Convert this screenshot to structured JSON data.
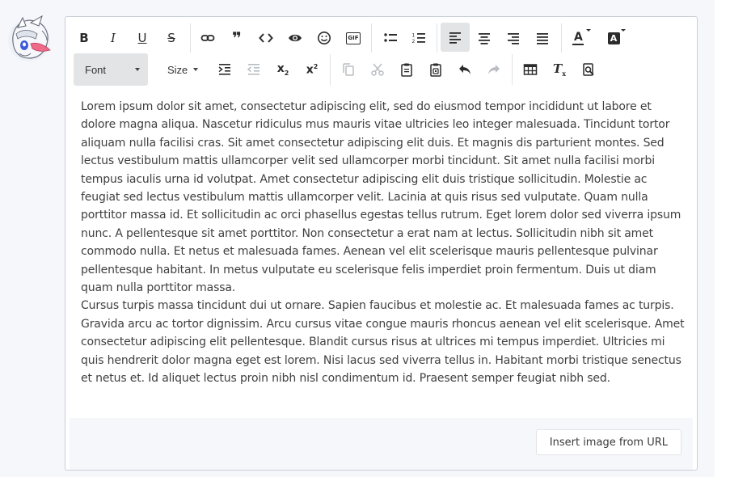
{
  "toolbar": {
    "font_label": "Font",
    "size_label": "Size",
    "gif_label": "GIF",
    "row1_icons": [
      "bold-icon",
      "italic-icon",
      "underline-icon",
      "strikethrough-icon",
      "link-icon",
      "quote-icon",
      "code-icon",
      "preview-eye-icon",
      "emoji-icon",
      "gif-icon",
      "bullet-list-icon",
      "numbered-list-icon",
      "align-left-icon",
      "align-center-icon",
      "align-right-icon",
      "align-justify-icon",
      "text-color-icon",
      "background-color-icon"
    ],
    "row2_icons": [
      "indent-icon",
      "outdent-icon",
      "subscript-icon",
      "superscript-icon",
      "copy-icon",
      "cut-icon",
      "paste-icon",
      "paste-word-icon",
      "undo-icon",
      "redo-icon",
      "table-icon",
      "clear-format-icon",
      "find-replace-icon"
    ],
    "active": [
      "align-left"
    ],
    "disabled": [
      "outdent",
      "copy",
      "cut",
      "redo"
    ],
    "bold_glyph": "B",
    "italic_glyph": "I",
    "underline_glyph": "U",
    "strike_glyph": "S",
    "quote_glyph": "❞",
    "code_glyph": "<>",
    "subscript_glyph": "x",
    "subscript_mark": "2",
    "superscript_glyph": "x",
    "superscript_mark": "2",
    "textcolor_glyph": "A",
    "bgcolor_glyph": "A",
    "clearformat_glyph": "T",
    "clearformat_mark": "x"
  },
  "content": {
    "paragraphs": [
      "Lorem ipsum dolor sit amet, consectetur adipiscing elit, sed do eiusmod tempor incididunt ut labore et dolore magna aliqua. Nascetur ridiculus mus mauris vitae ultricies leo integer malesuada. Tincidunt tortor aliquam nulla facilisi cras. Sit amet consectetur adipiscing elit duis. Et magnis dis parturient montes. Sed lectus vestibulum mattis ullamcorper velit sed ullamcorper morbi tincidunt. Sit amet nulla facilisi morbi tempus iaculis urna id volutpat. Amet consectetur adipiscing elit duis tristique sollicitudin. Molestie ac feugiat sed lectus vestibulum mattis ullamcorper velit. Lacinia at quis risus sed vulputate. Quam nulla porttitor massa id. Et sollicitudin ac orci phasellus egestas tellus rutrum. Eget lorem dolor sed viverra ipsum nunc. A pellentesque sit amet porttitor. Non consectetur a erat nam at lectus. Sollicitudin nibh sit amet commodo nulla. Et netus et malesuada fames. Aenean vel elit scelerisque mauris pellentesque pulvinar pellentesque habitant. In metus vulputate eu scelerisque felis imperdiet proin fermentum. Duis ut diam quam nulla porttitor massa.",
      "Cursus turpis massa tincidunt dui ut ornare. Sapien faucibus et molestie ac. Et malesuada fames ac turpis. Gravida arcu ac tortor dignissim. Arcu cursus vitae congue mauris rhoncus aenean vel elit scelerisque. Amet consectetur adipiscing elit pellentesque. Blandit cursus risus at ultrices mi tempus imperdiet. Ultricies mi quis hendrerit dolor magna eget est lorem. Nisi lacus sed viverra tellus in. Habitant morbi tristique senectus et netus et. Id aliquet lectus proin nibh nisl condimentum id. Praesent semper feugiat nibh sed."
    ]
  },
  "footer": {
    "insert_image_label": "Insert image from URL"
  },
  "colors": {
    "accent_active_bg": "#e3e4e6",
    "text": "#3f3f3f",
    "border": "#c9ced6",
    "page_bg": "#f5f7fa"
  }
}
